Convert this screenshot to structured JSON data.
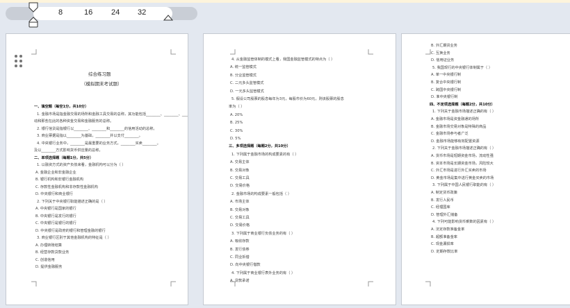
{
  "ruler": {
    "ticks": [
      "8",
      "16",
      "24",
      "32"
    ]
  },
  "pages": [
    {
      "title": "综合练习题",
      "subtitle": "（模拟期末考试题）",
      "lines": [
        {
          "t": "一、填空题（每空1分，共10分）",
          "h": true
        },
        {
          "t": "1. 金融市场是指金融交易的场所和金融工具交易的总称，其功能包括________、________、________、________和反映经济状况等。"
        },
        {
          "t": "动和那些在此的各种资金交易和金融服务的总称。"
        },
        {
          "t": "2. 银行信贷是指银行以________、________和________的信用活动的总称。"
        },
        {
          "t": "3. 商业票据是指以________为基础，________并以支付________。"
        },
        {
          "t": "4. 中央银行业务中，________是最重要的业务方式，________买卖________。"
        },
        {
          "t": "及以________方式影响货币供应量的总称。"
        },
        {
          "t": "二、单项选择题（每题1分，共5分）",
          "h": true
        },
        {
          "t": "1. 以融资方式的资产负债来看，金融机构可以分为（ ）"
        },
        {
          "t": "A. 金融企业和非金融企业"
        },
        {
          "t": "B. 银行机构和非银行金融机构"
        },
        {
          "t": "C. 存款性金融机构和非存款性金融机构"
        },
        {
          "t": "D. 中央银行和商业银行"
        },
        {
          "t": "2. 下列关于中央银行职能描述正确的是（ ）"
        },
        {
          "t": "A. 中央银行是国家的银行"
        },
        {
          "t": "B. 中央银行是发行的银行"
        },
        {
          "t": "C. 中央银行是银行的银行"
        },
        {
          "t": "D. 中央银行是政府的银行和管理金融的银行"
        },
        {
          "t": "3. 商业银行区别于其他金融机构的特征是（ ）"
        },
        {
          "t": "A. 办理转账结算"
        },
        {
          "t": "B. 经营存款贷款业务"
        },
        {
          "t": "C. 创造信用"
        },
        {
          "t": "D. 提供金融服务"
        }
      ]
    },
    {
      "lines": [
        {
          "t": "4. 从金融监管体制的模式上看，我国金融监管模式的特点为（ ）"
        },
        {
          "t": "A. 统一监管模式"
        },
        {
          "t": "B. 分业监管模式"
        },
        {
          "t": "C. 二元多头监管模式"
        },
        {
          "t": "D. 一元多头监管模式"
        },
        {
          "t": "5. 假设公司股票的股息每年为3元，每股市价为60元，则该股票的股息"
        },
        {
          "t": "率为（ ）"
        },
        {
          "t": "A. 20%"
        },
        {
          "t": "B. 25%"
        },
        {
          "t": "C. 30%"
        },
        {
          "t": "D. 5%"
        },
        {
          "t": "三、多项选择题（每题2分，共10分）",
          "h": true
        },
        {
          "t": "1. 下列属于金融市场的构成要素的有（ ）"
        },
        {
          "t": "A. 交易主体"
        },
        {
          "t": "B. 交易对象"
        },
        {
          "t": "C. 交易工具"
        },
        {
          "t": "D. 交易价格"
        },
        {
          "t": "2. 金融市场的构成要素一般包括（ ）"
        },
        {
          "t": "A. 市场主体"
        },
        {
          "t": "B. 交易对象"
        },
        {
          "t": "C. 交易工具"
        },
        {
          "t": "D. 交易价格"
        },
        {
          "t": "3. 下列属于商业银行负债业务的有（ ）"
        },
        {
          "t": "A. 吸收存款"
        },
        {
          "t": "B. 发行债券"
        },
        {
          "t": "C. 同业拆借"
        },
        {
          "t": "D. 向中央银行借款"
        },
        {
          "t": "4. 下列属于商业银行表外业务的有（ ）"
        },
        {
          "t": "A. 贷款承诺"
        }
      ]
    },
    {
      "lines": [
        {
          "t": "B. 外汇期货业务"
        },
        {
          "t": "C. 互换业务"
        },
        {
          "t": "D. 信用证业务"
        },
        {
          "t": "5. 我国现行的中央银行体制属于（ ）"
        },
        {
          "t": "A. 单一中央银行制"
        },
        {
          "t": "B. 复合中央银行制"
        },
        {
          "t": "C. 跨国中央银行制"
        },
        {
          "t": "D. 准中央银行制"
        },
        {
          "t": "四、不定项选择题（每题2分，共10分）",
          "h": true
        },
        {
          "t": "1. 下列关于金融市场描述正确的有（ ）"
        },
        {
          "t": "A. 金融市场是资金融通的场所"
        },
        {
          "t": "B. 金融市场交易对象是特殊的商品"
        },
        {
          "t": "C. 金融市场参与者广泛"
        },
        {
          "t": "D. 金融市场能够有效配置资源"
        },
        {
          "t": "2. 下列关于金融市场描述正确的有（ ）"
        },
        {
          "t": "A. 货币市场是短期资金市场，流动性强"
        },
        {
          "t": "B. 资本市场是长期资金市场，风险较大"
        },
        {
          "t": "C. 外汇市场是进行外汇买卖的市场"
        },
        {
          "t": "D. 黄金市场是集中进行黄金买卖的市场"
        },
        {
          "t": "3. 下列属于中国人民银行职能的有（ ）"
        },
        {
          "t": "A. 制定货币政策"
        },
        {
          "t": "B. 发行人民币"
        },
        {
          "t": "C. 经理国库"
        },
        {
          "t": "D. 管理外汇储备"
        },
        {
          "t": "4. 下列可能影响货币乘数的因素有（ ）"
        },
        {
          "t": "A. 法定存款准备金率"
        },
        {
          "t": "B. 超额准备金率"
        },
        {
          "t": "C. 现金漏损率"
        },
        {
          "t": "D. 定期存款比率"
        }
      ]
    }
  ]
}
